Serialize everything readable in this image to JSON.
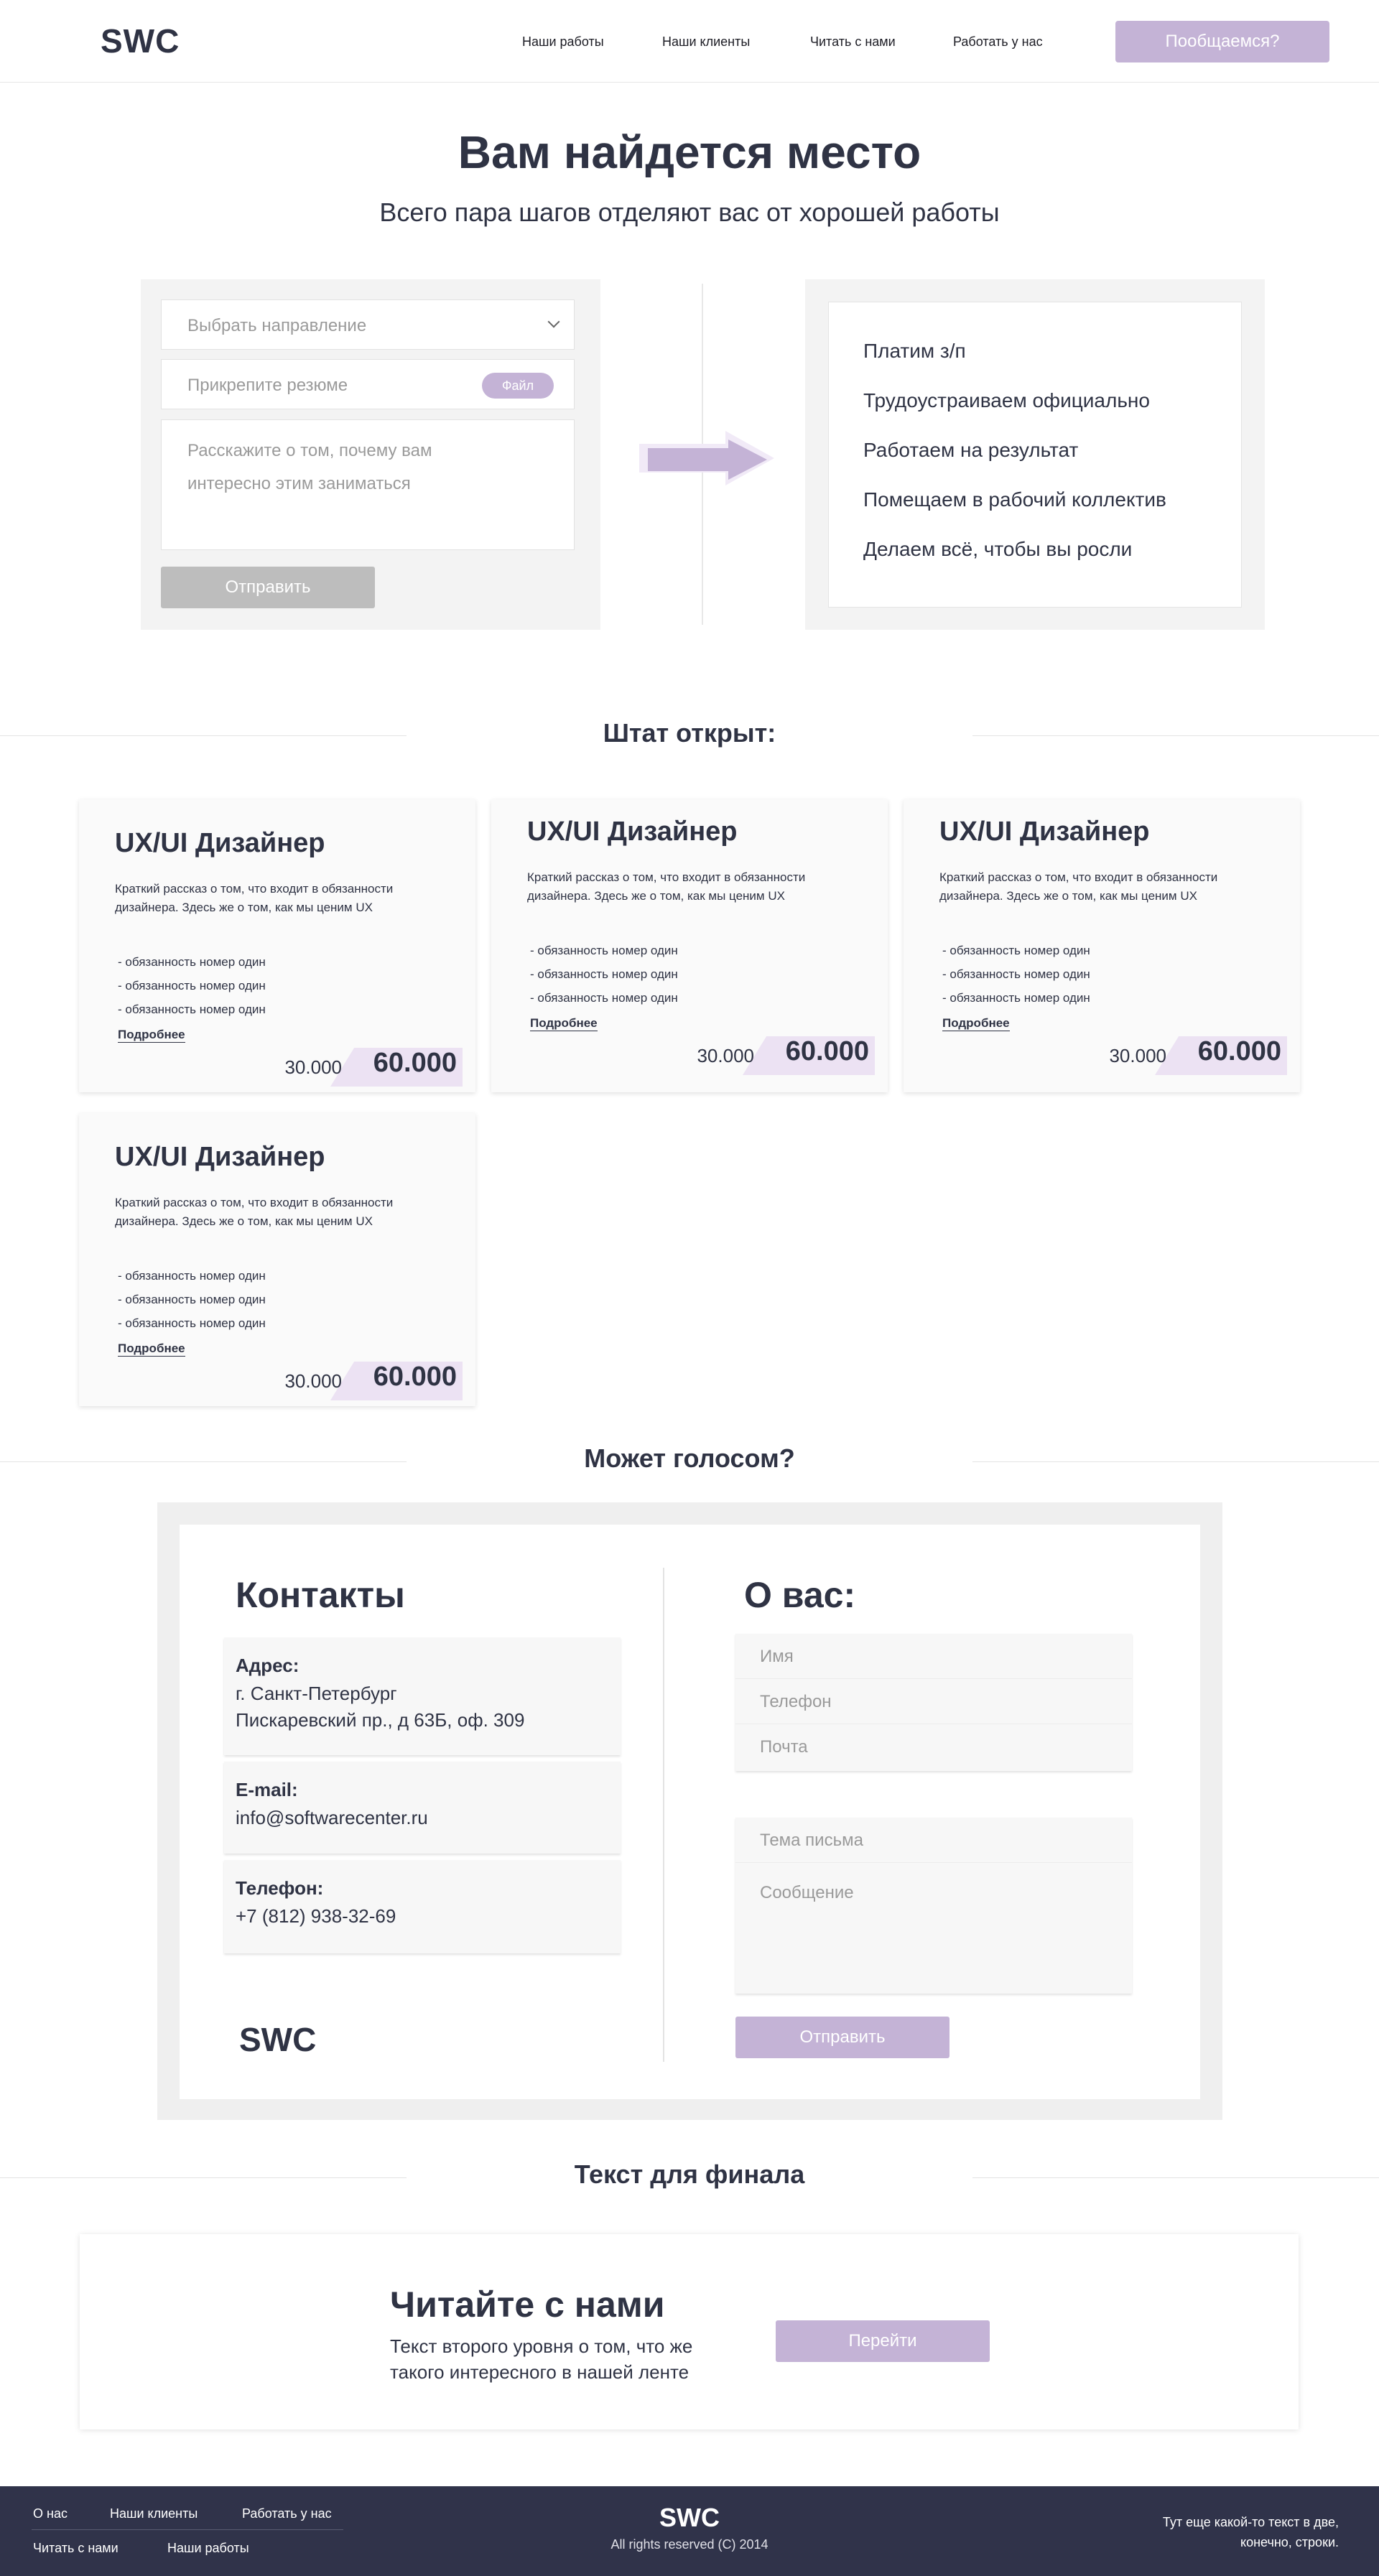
{
  "header": {
    "logo": "SWC",
    "nav": [
      "Наши работы",
      "Наши клиенты",
      "Читать с нами",
      "Работать у нас"
    ],
    "cta": "Пообщаемся?"
  },
  "hero": {
    "title": "Вам найдется место",
    "subtitle": "Всего пара шагов отделяют вас от хорошей работы"
  },
  "apply_form": {
    "direction_placeholder": "Выбрать направление",
    "resume_placeholder": "Прикрепите резюме",
    "file_button": "Файл",
    "about_placeholder": "Расскажите о том, почему вам интересно этим заниматься",
    "submit": "Отправить"
  },
  "benefits": [
    "Платим з/п",
    "Трудоустраиваем официально",
    "Работаем на результат",
    "Помещаем в рабочий коллектив",
    "Делаем всё, чтобы вы росли"
  ],
  "vacancies_title": "Штат открыт:",
  "vacancies": [
    {
      "title": "UX/UI Дизайнер",
      "description": "Краткий рассказ о том, что входит в обязанности дизайнера. Здесь же о том, как мы ценим UX",
      "duties": [
        "- обязанность номер один",
        "- обязанность номер один",
        "- обязанность номер один"
      ],
      "more": "Подробнее",
      "price_min": "30.000",
      "price_max": "60.000"
    },
    {
      "title": "UX/UI Дизайнер",
      "description": "Краткий рассказ о том, что входит в обязанности дизайнера. Здесь же о том, как мы ценим UX",
      "duties": [
        "- обязанность номер один",
        "- обязанность номер один",
        "- обязанность номер один"
      ],
      "more": "Подробнее",
      "price_min": "30.000",
      "price_max": "60.000"
    },
    {
      "title": "UX/UI Дизайнер",
      "description": "Краткий рассказ о том, что входит в обязанности дизайнера. Здесь же о том, как мы ценим UX",
      "duties": [
        "- обязанность номер один",
        "- обязанность номер один",
        "- обязанность номер один"
      ],
      "more": "Подробнее",
      "price_min": "30.000",
      "price_max": "60.000"
    },
    {
      "title": "UX/UI Дизайнер",
      "description": "Краткий рассказ о том, что входит в обязанности дизайнера. Здесь же о том, как мы ценим UX",
      "duties": [
        "- обязанность номер один",
        "- обязанность номер один",
        "- обязанность номер один"
      ],
      "more": "Подробнее",
      "price_min": "30.000",
      "price_max": "60.000"
    }
  ],
  "voice_title": "Может голосом?",
  "contacts": {
    "title": "Контакты",
    "address_label": "Адрес:",
    "address_line1": "г. Санкт-Петербург",
    "address_line2": "Пискаревский пр., д 63Б, оф. 309",
    "email_label": "E-mail:",
    "email": "info@softwarecenter.ru",
    "phone_label": "Телефон:",
    "phone": "+7 (812) 938-32-69",
    "logo": "SWC"
  },
  "about_form": {
    "title": "О вас:",
    "name_placeholder": "Имя",
    "phone_placeholder": "Телефон",
    "email_placeholder": "Почта",
    "subject_placeholder": "Тема письма",
    "message_placeholder": "Сообщение",
    "submit": "Отправить"
  },
  "final": {
    "section_title": "Текст для финала",
    "title": "Читайте с нами",
    "description": "Текст второго уровня о том, что же такого интересного в нашей ленте",
    "button": "Перейти"
  },
  "footer": {
    "links_row1": [
      "О нас",
      "Наши клиенты",
      "Работать у нас"
    ],
    "links_row2": [
      "Читать с нами",
      "Наши работы"
    ],
    "logo": "SWC",
    "copyright": "All rights reserved (C) 2014",
    "note": "Тут еще какой-то текст в две, конечно, строки."
  },
  "colors": {
    "accent": "#c4b3d6",
    "text": "#2f3344",
    "footer_bg": "#30334a"
  }
}
